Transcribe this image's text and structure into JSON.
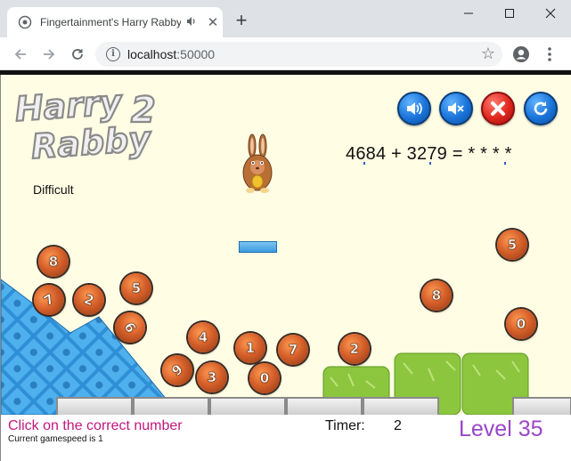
{
  "browser": {
    "tab_title": "Fingertainment's Harry Rabby 2",
    "url_host": "localhost",
    "url_port": ":50000",
    "new_tab_label": "+"
  },
  "game": {
    "logo": {
      "line1": "Harry",
      "line2": "Rabby",
      "number": "2"
    },
    "difficulty": "Difficult",
    "equation": "4684 + 3279 =  * * * *",
    "balls": [
      {
        "digit": "8"
      },
      {
        "digit": "7"
      },
      {
        "digit": "2"
      },
      {
        "digit": "5"
      },
      {
        "digit": "6"
      },
      {
        "digit": "4"
      },
      {
        "digit": "9"
      },
      {
        "digit": "3"
      },
      {
        "digit": "1"
      },
      {
        "digit": "0"
      },
      {
        "digit": "7"
      },
      {
        "digit": "2"
      },
      {
        "digit": "8"
      },
      {
        "digit": "5"
      },
      {
        "digit": "0"
      }
    ],
    "controls": [
      "sound-on-icon",
      "mute-icon",
      "close-icon",
      "restart-icon"
    ]
  },
  "status": {
    "message": "Click on the correct number",
    "gamespeed": "Current gamespeed is 1",
    "timer_label": "Timer:",
    "timer_value": "2",
    "level": "Level 35"
  },
  "colors": {
    "game_bg": "#fffde4",
    "message": "#c2187f",
    "level": "#9b45c8",
    "ball": "#d6602a"
  }
}
